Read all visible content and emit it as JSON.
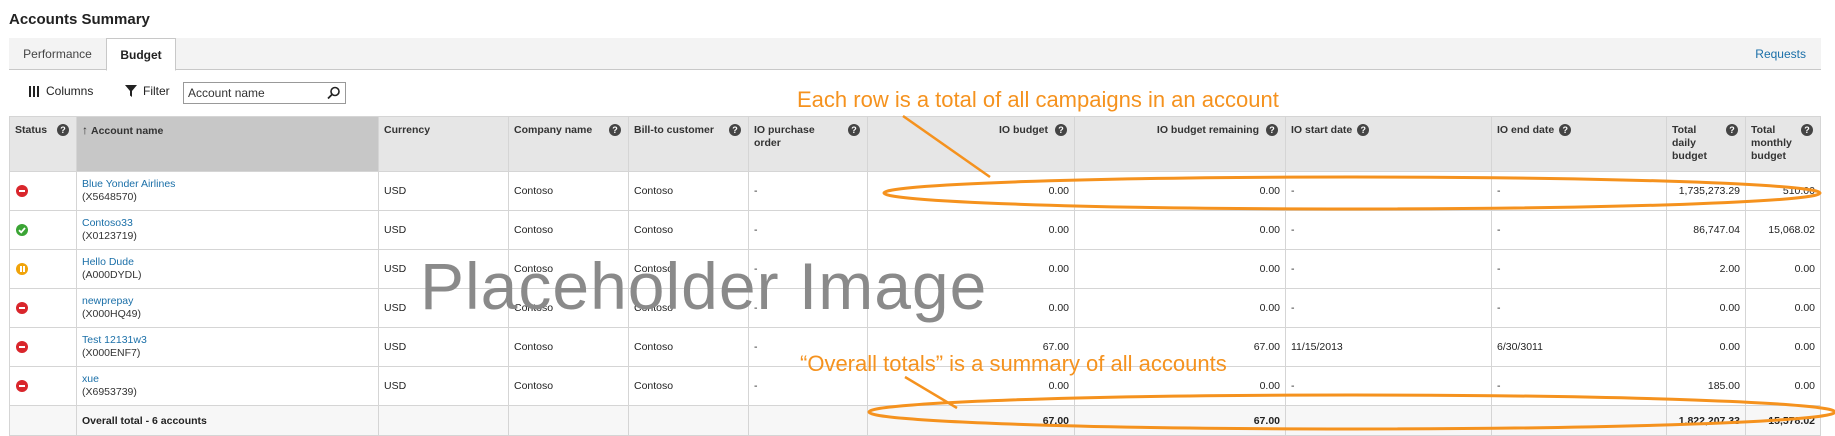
{
  "page_title": "Accounts Summary",
  "tabs": [
    {
      "label": "Performance"
    },
    {
      "label": "Budget"
    }
  ],
  "requests_link": "Requests",
  "toolbar": {
    "columns_label": "Columns",
    "filter_label": "Filter",
    "search_placeholder": "Account name"
  },
  "columns": [
    {
      "label": "Status"
    },
    {
      "label": "Account name"
    },
    {
      "label": "Currency"
    },
    {
      "label": "Company name"
    },
    {
      "label": "Bill-to customer"
    },
    {
      "label": "IO purchase order"
    },
    {
      "label": "IO budget"
    },
    {
      "label": "IO budget remaining"
    },
    {
      "label": "IO start date"
    },
    {
      "label": "IO end date"
    },
    {
      "label": "Total daily budget"
    },
    {
      "label": "Total monthly budget"
    }
  ],
  "rows": [
    {
      "status": "error",
      "name": "Blue Yonder Airlines",
      "id": "(X5648570)",
      "currency": "USD",
      "company": "Contoso",
      "bill_to": "Contoso",
      "po": "-",
      "io_budget": "0.00",
      "io_remaining": "0.00",
      "start": "-",
      "end": "-",
      "daily": "1,735,273.29",
      "monthly": "510.00"
    },
    {
      "status": "active",
      "name": "Contoso33",
      "id": "(X0123719)",
      "currency": "USD",
      "company": "Contoso",
      "bill_to": "Contoso",
      "po": "-",
      "io_budget": "0.00",
      "io_remaining": "0.00",
      "start": "-",
      "end": "-",
      "daily": "86,747.04",
      "monthly": "15,068.02"
    },
    {
      "status": "paused",
      "name": "Hello Dude",
      "id": "(A000DYDL)",
      "currency": "USD",
      "company": "Contoso",
      "bill_to": "Contoso",
      "po": "-",
      "io_budget": "0.00",
      "io_remaining": "0.00",
      "start": "-",
      "end": "-",
      "daily": "2.00",
      "monthly": "0.00"
    },
    {
      "status": "error",
      "name": "newprepay",
      "id": "(X000HQ49)",
      "currency": "USD",
      "company": "Contoso",
      "bill_to": "Contoso",
      "po": "-",
      "io_budget": "0.00",
      "io_remaining": "0.00",
      "start": "-",
      "end": "-",
      "daily": "0.00",
      "monthly": "0.00"
    },
    {
      "status": "error",
      "name": "Test 12131w3",
      "id": "(X000ENF7)",
      "currency": "USD",
      "company": "Contoso",
      "bill_to": "Contoso",
      "po": "-",
      "io_budget": "67.00",
      "io_remaining": "67.00",
      "start": "11/15/2013",
      "end": "6/30/3011",
      "daily": "0.00",
      "monthly": "0.00"
    },
    {
      "status": "error",
      "name": "xue",
      "id": "(X6953739)",
      "currency": "USD",
      "company": "Contoso",
      "bill_to": "Contoso",
      "po": "-",
      "io_budget": "0.00",
      "io_remaining": "0.00",
      "start": "-",
      "end": "-",
      "daily": "185.00",
      "monthly": "0.00"
    }
  ],
  "totals": {
    "label": "Overall total - 6 accounts",
    "io_budget": "67.00",
    "io_remaining": "67.00",
    "daily": "1,822,207.33",
    "monthly": "15,578.02"
  },
  "placeholder_text": "Placeholder Image",
  "annotations": {
    "rows_note": "Each row is a total of all campaigns in an account",
    "totals_note": "“Overall totals” is a summary of all accounts"
  },
  "colors": {
    "accent": "#f5921e",
    "link": "#1a6fa8",
    "error": "#d9262c",
    "active": "#3aa434",
    "paused": "#f0a30a"
  }
}
